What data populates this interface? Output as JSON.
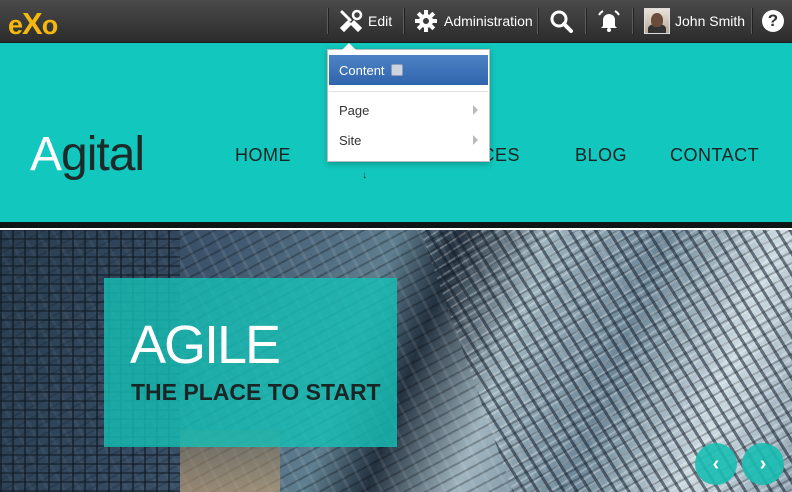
{
  "toolbar": {
    "logo": {
      "e": "e",
      "x": "X",
      "o": "o"
    },
    "edit_label": "Edit",
    "admin_label": "Administration",
    "user_name": "John Smith",
    "help_symbol": "?",
    "icons": {
      "edit": "tools-icon",
      "admin": "gear-icon",
      "search": "search-icon",
      "notifications": "bell-icon",
      "help": "help-icon"
    }
  },
  "edit_menu": {
    "active_item": "Content",
    "items": [
      {
        "label": "Page"
      },
      {
        "label": "Site"
      }
    ]
  },
  "site": {
    "brand_first": "A",
    "brand_rest": "gital",
    "nav": [
      "HOME",
      "ICES",
      "BLOG",
      "CONTACT"
    ],
    "cursor_glyph": "↓"
  },
  "hero": {
    "title": "AGILE",
    "subtitle": "THE PLACE TO START",
    "prev_symbol": "‹",
    "next_symbol": "›"
  },
  "colors": {
    "accent": "#12c7bd",
    "toolbar": "#3a3a3a",
    "menu_active": "#3b71b8",
    "logo": "#f5b80f"
  }
}
